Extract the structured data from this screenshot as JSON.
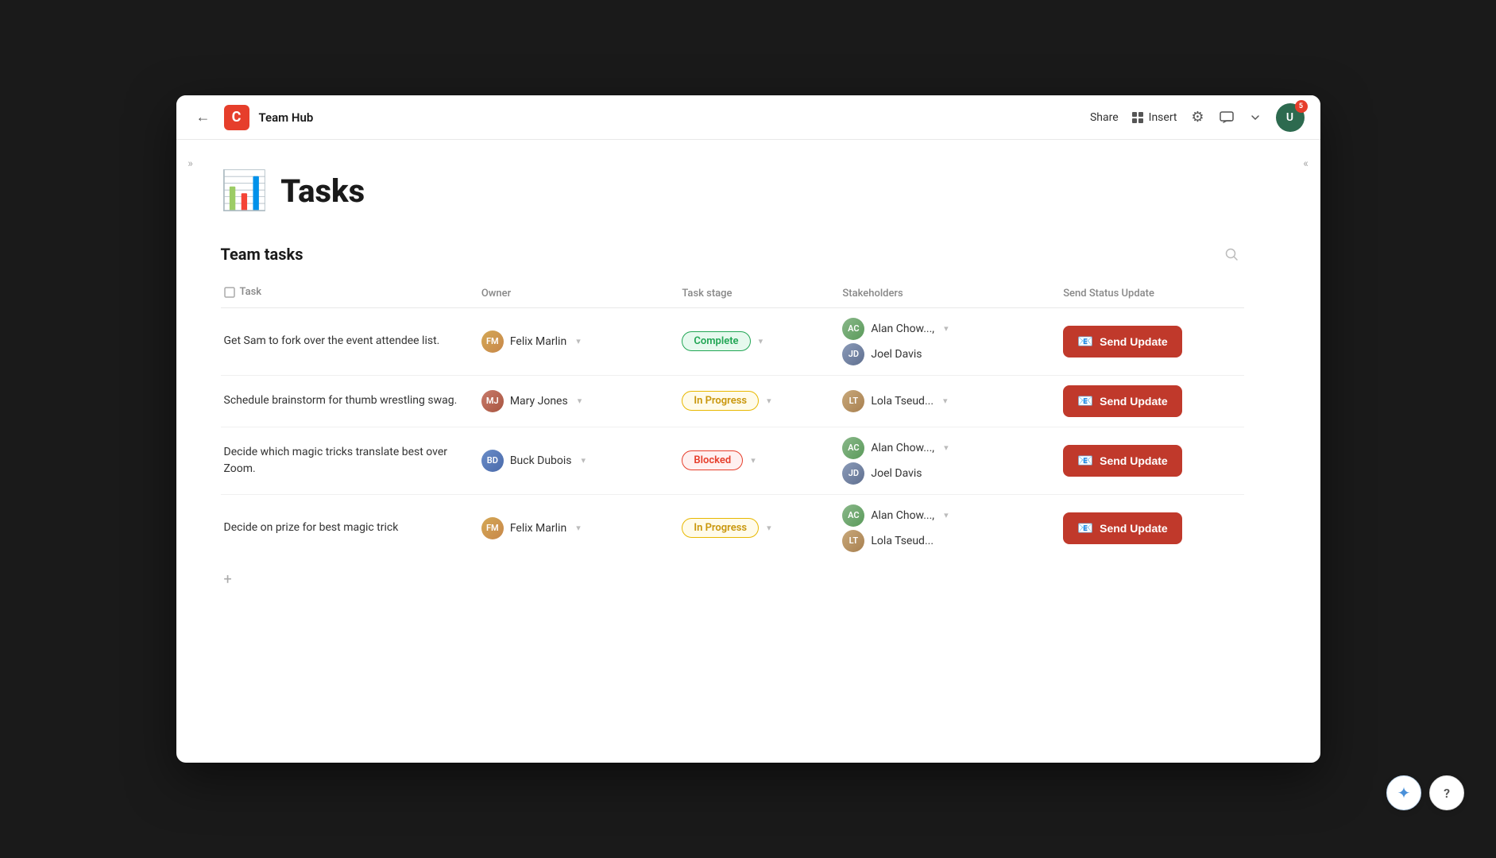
{
  "topbar": {
    "back_icon": "←",
    "logo_letter": "C",
    "title": "Team Hub",
    "share_label": "Share",
    "insert_label": "Insert",
    "settings_icon": "⚙",
    "chat_icon": "💬",
    "avatar_initials": "U",
    "avatar_badge": "5"
  },
  "left_collapse": {
    "icon": "»"
  },
  "right_collapse": {
    "icon": "«"
  },
  "page": {
    "icon": "📊",
    "title": "Tasks"
  },
  "table": {
    "section_title": "Team tasks",
    "search_icon": "🔍",
    "columns": {
      "task": "Task",
      "owner": "Owner",
      "stage": "Task stage",
      "stakeholders": "Stakeholders",
      "send": "Send Status Update"
    },
    "rows": [
      {
        "id": 1,
        "task": "Get Sam to fork over the event attendee list.",
        "owner": {
          "name": "Felix Marlin",
          "initials": "FM",
          "color": "av-felix"
        },
        "stage": {
          "label": "Complete",
          "type": "complete"
        },
        "stakeholders": [
          {
            "name": "Alan Chow...,",
            "initials": "AC",
            "color": "av-alan"
          },
          {
            "name": "Joel Davis",
            "initials": "JD",
            "color": "av-joel"
          }
        ],
        "send_label": "Send Update"
      },
      {
        "id": 2,
        "task": "Schedule brainstorm for thumb wrestling swag.",
        "owner": {
          "name": "Mary Jones",
          "initials": "MJ",
          "color": "av-mary"
        },
        "stage": {
          "label": "In Progress",
          "type": "inprogress"
        },
        "stakeholders": [
          {
            "name": "Lola Tseud...",
            "initials": "LT",
            "color": "av-lola"
          }
        ],
        "send_label": "Send Update"
      },
      {
        "id": 3,
        "task": "Decide which magic tricks translate best over Zoom.",
        "owner": {
          "name": "Buck Dubois",
          "initials": "BD",
          "color": "av-buck"
        },
        "stage": {
          "label": "Blocked",
          "type": "blocked"
        },
        "stakeholders": [
          {
            "name": "Alan Chow...,",
            "initials": "AC",
            "color": "av-alan"
          },
          {
            "name": "Joel Davis",
            "initials": "JD",
            "color": "av-joel"
          }
        ],
        "send_label": "Send Update"
      },
      {
        "id": 4,
        "task": "Decide on prize for best magic trick",
        "owner": {
          "name": "Felix Marlin",
          "initials": "FM",
          "color": "av-felix"
        },
        "stage": {
          "label": "In Progress",
          "type": "inprogress"
        },
        "stakeholders": [
          {
            "name": "Alan Chow...,",
            "initials": "AC",
            "color": "av-alan"
          },
          {
            "name": "Lola Tseud...",
            "initials": "LT",
            "color": "av-lola"
          }
        ],
        "send_label": "Send Update"
      }
    ],
    "add_row_icon": "+",
    "send_icon": "📧"
  },
  "floating": {
    "sparkle_icon": "✦",
    "help_icon": "?"
  }
}
